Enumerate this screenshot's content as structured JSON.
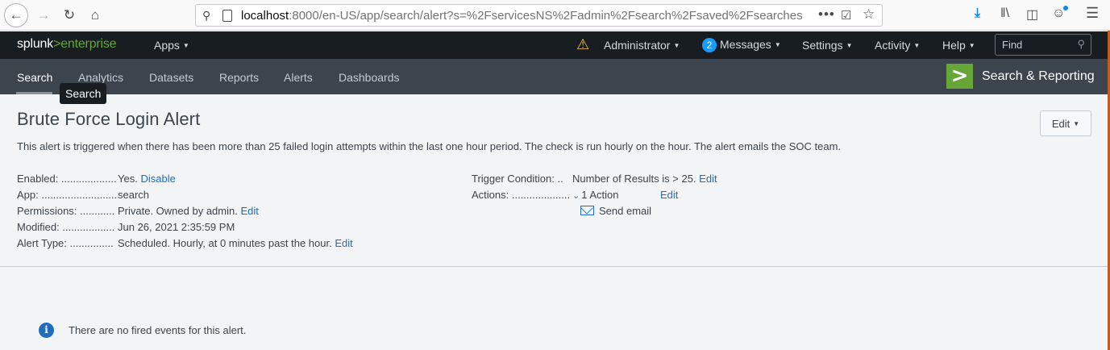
{
  "browser": {
    "url_host": "localhost",
    "url_rest": ":8000/en-US/app/search/alert?s=%2FservicesNS%2Fadmin%2Fsearch%2Fsaved%2Fsearches",
    "overflow_dots": "•••"
  },
  "top_bar": {
    "logo_brand": "splunk",
    "logo_gt": ">",
    "logo_product": "enterprise",
    "apps_label": "Apps",
    "user_label": "Administrator",
    "messages_count": "2",
    "messages_label": "Messages",
    "settings_label": "Settings",
    "activity_label": "Activity",
    "help_label": "Help",
    "find_placeholder": "Find"
  },
  "app_nav": {
    "tabs": [
      {
        "label": "Search"
      },
      {
        "label": "Analytics"
      },
      {
        "label": "Datasets"
      },
      {
        "label": "Reports"
      },
      {
        "label": "Alerts"
      },
      {
        "label": "Dashboards"
      }
    ],
    "app_name": "Search & Reporting",
    "app_logo_glyph": ">",
    "tooltip": "Search"
  },
  "alert": {
    "title": "Brute Force Login Alert",
    "edit_label": "Edit",
    "description": "This alert is triggered when there has been more than 25 failed login attempts within the last one hour period. The check is run hourly on the hour. The alert emails the SOC team.",
    "enabled_label": "Enabled: ...................",
    "enabled_value": "Yes.",
    "enabled_link": "Disable",
    "app_label": "App: ..........................",
    "app_value": "search",
    "permissions_label": "Permissions: ............",
    "permissions_value": "Private. Owned by admin.",
    "permissions_link": "Edit",
    "modified_label": "Modified: ..................",
    "modified_value": "Jun 26, 2021 2:35:59 PM",
    "alert_type_label": "Alert Type: ...............",
    "alert_type_value": "Scheduled. Hourly, at 0 minutes past the hour.",
    "alert_type_link": "Edit",
    "trigger_label": "Trigger Condition: ..",
    "trigger_value": "Number of Results is > 25.",
    "trigger_link": "Edit",
    "actions_label": "Actions: ....................",
    "actions_value": "1 Action",
    "actions_link": "Edit",
    "action_item": "Send email"
  },
  "events": {
    "empty_message": "There are no fired events for this alert."
  }
}
